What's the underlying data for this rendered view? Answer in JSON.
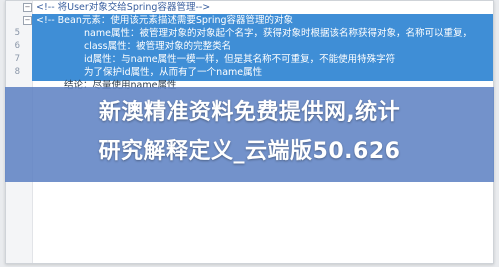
{
  "editor": {
    "lines": [
      {
        "num": "",
        "text": "<!-- 将User对象交给Spring容器管理-->"
      },
      {
        "num": "",
        "text": "<!-- Bean元素：使用该元素描述需要Spring容器管理的对象"
      },
      {
        "num": "5",
        "text": "name属性：被管理对象的对象起个名字，获得对象时根据该名称获得对象，名称可以重复，"
      },
      {
        "num": "6",
        "text": "class属性：被管理对象的完整类名"
      },
      {
        "num": "7",
        "text": "id属性：与name属性一模一样，但是其名称不可重复，不能使用特殊字符"
      },
      {
        "num": "8",
        "text": "为了保护id属性，从而有了一个name属性"
      },
      {
        "num": "",
        "text": "结论：尽量使用name属性"
      }
    ]
  },
  "overlay": {
    "headline_line1": "新澳精准资料免费提供网,统计",
    "headline_line2": "研究解释定义_云端版50.626"
  },
  "colors": {
    "selection": "#3f8ed6",
    "overlay": "#5c80c3"
  }
}
